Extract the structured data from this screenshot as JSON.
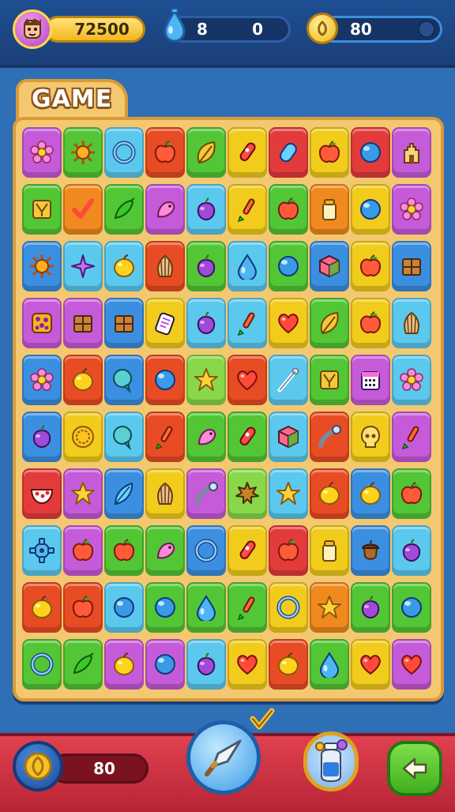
{
  "hud": {
    "coins": "72500",
    "gems_left": "8",
    "gems_right": "0",
    "gold": "80"
  },
  "board": {
    "title": "GAME",
    "rows": [
      [
        {
          "c": "#c65bd9",
          "i": "flower"
        },
        {
          "c": "#53c636",
          "i": "sun"
        },
        {
          "c": "#5bc8ee",
          "i": "ring"
        },
        {
          "c": "#e84c24",
          "i": "apple"
        },
        {
          "c": "#53c636",
          "i": "leaf"
        },
        {
          "c": "#f2cc1c",
          "i": "rocket"
        },
        {
          "c": "#e33b3b",
          "i": "capsule"
        },
        {
          "c": "#f2cc1c",
          "i": "apple"
        },
        {
          "c": "#e33b3b",
          "i": "orb"
        },
        {
          "c": "#c65bd9",
          "i": "castle"
        }
      ],
      [
        {
          "c": "#53c636",
          "i": "box"
        },
        {
          "c": "#f08a1e",
          "i": "check"
        },
        {
          "c": "#53c636",
          "i": "pepper"
        },
        {
          "c": "#c65bd9",
          "i": "bird"
        },
        {
          "c": "#5bc8ee",
          "i": "grape"
        },
        {
          "c": "#f2cc1c",
          "i": "brush"
        },
        {
          "c": "#53c636",
          "i": "apple"
        },
        {
          "c": "#f08a1e",
          "i": "jar"
        },
        {
          "c": "#f2cc1c",
          "i": "orb"
        },
        {
          "c": "#c65bd9",
          "i": "flower"
        }
      ],
      [
        {
          "c": "#3b8fe0",
          "i": "sun"
        },
        {
          "c": "#5bc8ee",
          "i": "star4"
        },
        {
          "c": "#5bc8ee",
          "i": "lemon"
        },
        {
          "c": "#e84c24",
          "i": "shell"
        },
        {
          "c": "#53c636",
          "i": "grape"
        },
        {
          "c": "#5bc8ee",
          "i": "drop"
        },
        {
          "c": "#53c636",
          "i": "orb"
        },
        {
          "c": "#3b8fe0",
          "i": "cube"
        },
        {
          "c": "#f2cc1c",
          "i": "apple"
        },
        {
          "c": "#3b8fe0",
          "i": "crate"
        }
      ],
      [
        {
          "c": "#c65bd9",
          "i": "cookie"
        },
        {
          "c": "#c65bd9",
          "i": "crate"
        },
        {
          "c": "#3b8fe0",
          "i": "crate"
        },
        {
          "c": "#f2cc1c",
          "i": "hand"
        },
        {
          "c": "#5bc8ee",
          "i": "grape"
        },
        {
          "c": "#5bc8ee",
          "i": "brush"
        },
        {
          "c": "#f2cc1c",
          "i": "heart"
        },
        {
          "c": "#53c636",
          "i": "leaf"
        },
        {
          "c": "#f2cc1c",
          "i": "apple"
        },
        {
          "c": "#5bc8ee",
          "i": "shell"
        }
      ],
      [
        {
          "c": "#3b8fe0",
          "i": "flower"
        },
        {
          "c": "#e84c24",
          "i": "lemon"
        },
        {
          "c": "#3b8fe0",
          "i": "bubble"
        },
        {
          "c": "#e84c24",
          "i": "orb"
        },
        {
          "c": "#88d84a",
          "i": "star"
        },
        {
          "c": "#e84c24",
          "i": "heart"
        },
        {
          "c": "#5bc8ee",
          "i": "needle"
        },
        {
          "c": "#53c636",
          "i": "box"
        },
        {
          "c": "#c65bd9",
          "i": "calendar"
        },
        {
          "c": "#5bc8ee",
          "i": "flower"
        }
      ],
      [
        {
          "c": "#3b8fe0",
          "i": "grape"
        },
        {
          "c": "#f2cc1c",
          "i": "coin"
        },
        {
          "c": "#5bc8ee",
          "i": "bubble"
        },
        {
          "c": "#e84c24",
          "i": "brush"
        },
        {
          "c": "#53c636",
          "i": "bird"
        },
        {
          "c": "#53c636",
          "i": "rocket"
        },
        {
          "c": "#5bc8ee",
          "i": "cube"
        },
        {
          "c": "#e84c24",
          "i": "pipe"
        },
        {
          "c": "#f2cc1c",
          "i": "skull"
        },
        {
          "c": "#c65bd9",
          "i": "brush"
        }
      ],
      [
        {
          "c": "#e33b3b",
          "i": "bowl"
        },
        {
          "c": "#c65bd9",
          "i": "star"
        },
        {
          "c": "#3b8fe0",
          "i": "feather"
        },
        {
          "c": "#f2cc1c",
          "i": "shell"
        },
        {
          "c": "#c65bd9",
          "i": "pipe"
        },
        {
          "c": "#88d84a",
          "i": "maple"
        },
        {
          "c": "#5bc8ee",
          "i": "star"
        },
        {
          "c": "#e84c24",
          "i": "lemon"
        },
        {
          "c": "#3b8fe0",
          "i": "lemon"
        },
        {
          "c": "#53c636",
          "i": "apple"
        }
      ],
      [
        {
          "c": "#5bc8ee",
          "i": "gear"
        },
        {
          "c": "#c65bd9",
          "i": "apple"
        },
        {
          "c": "#53c636",
          "i": "apple"
        },
        {
          "c": "#53c636",
          "i": "bird"
        },
        {
          "c": "#3b8fe0",
          "i": "ring"
        },
        {
          "c": "#f2cc1c",
          "i": "rocket"
        },
        {
          "c": "#e33b3b",
          "i": "apple"
        },
        {
          "c": "#f2cc1c",
          "i": "jar"
        },
        {
          "c": "#3b8fe0",
          "i": "acorn"
        },
        {
          "c": "#5bc8ee",
          "i": "grape"
        }
      ],
      [
        {
          "c": "#e84c24",
          "i": "lemon"
        },
        {
          "c": "#e84c24",
          "i": "apple"
        },
        {
          "c": "#5bc8ee",
          "i": "orb"
        },
        {
          "c": "#53c636",
          "i": "orb"
        },
        {
          "c": "#53c636",
          "i": "drop"
        },
        {
          "c": "#53c636",
          "i": "brush"
        },
        {
          "c": "#f2cc1c",
          "i": "ring"
        },
        {
          "c": "#f08a1e",
          "i": "star"
        },
        {
          "c": "#53c636",
          "i": "grape"
        },
        {
          "c": "#53c636",
          "i": "orb"
        }
      ],
      [
        {
          "c": "#53c636",
          "i": "ring"
        },
        {
          "c": "#53c636",
          "i": "pepper"
        },
        {
          "c": "#c65bd9",
          "i": "lemon"
        },
        {
          "c": "#c65bd9",
          "i": "orb"
        },
        {
          "c": "#5bc8ee",
          "i": "grape"
        },
        {
          "c": "#f2cc1c",
          "i": "heart"
        },
        {
          "c": "#e84c24",
          "i": "lemon"
        },
        {
          "c": "#53c636",
          "i": "drop"
        },
        {
          "c": "#f2cc1c",
          "i": "heart"
        },
        {
          "c": "#c65bd9",
          "i": "heart"
        }
      ]
    ]
  },
  "bottom": {
    "moves": "80"
  }
}
